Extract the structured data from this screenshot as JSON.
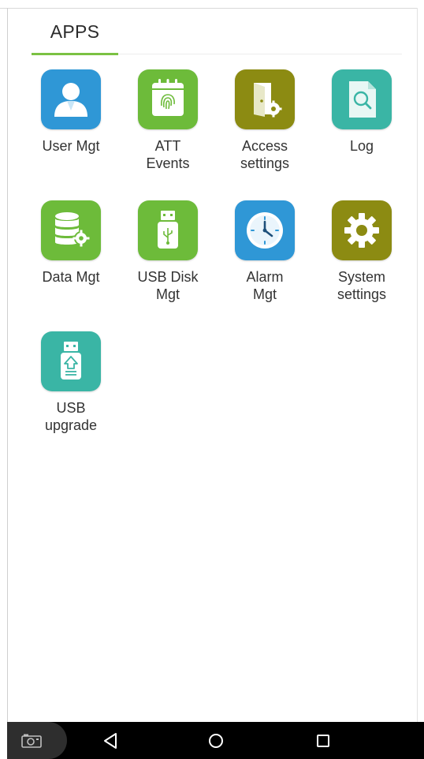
{
  "tabs": [
    {
      "label": "APPS",
      "active": true
    }
  ],
  "accent_color": "#7bc143",
  "apps": [
    {
      "label": "User Mgt",
      "icon": "user-icon",
      "color": "#2f97d6"
    },
    {
      "label": "ATT\nEvents",
      "icon": "fingerprint-calendar-icon",
      "color": "#6dbb3a"
    },
    {
      "label": "Access\nsettings",
      "icon": "door-gear-icon",
      "color": "#8c8b12"
    },
    {
      "label": "Log",
      "icon": "document-search-icon",
      "color": "#3ab5a5"
    },
    {
      "label": "Data Mgt",
      "icon": "database-gear-icon",
      "color": "#6dbb3a"
    },
    {
      "label": "USB Disk\nMgt",
      "icon": "usb-drive-icon",
      "color": "#6dbb3a"
    },
    {
      "label": "Alarm\nMgt",
      "icon": "clock-icon",
      "color": "#2f97d6"
    },
    {
      "label": "System\nsettings",
      "icon": "gear-icon",
      "color": "#8c8b12"
    },
    {
      "label": "USB\nupgrade",
      "icon": "usb-upgrade-icon",
      "color": "#3ab5a5"
    }
  ],
  "navbar": {
    "buttons": [
      "camera-icon",
      "back-icon",
      "home-icon",
      "recents-icon"
    ]
  }
}
